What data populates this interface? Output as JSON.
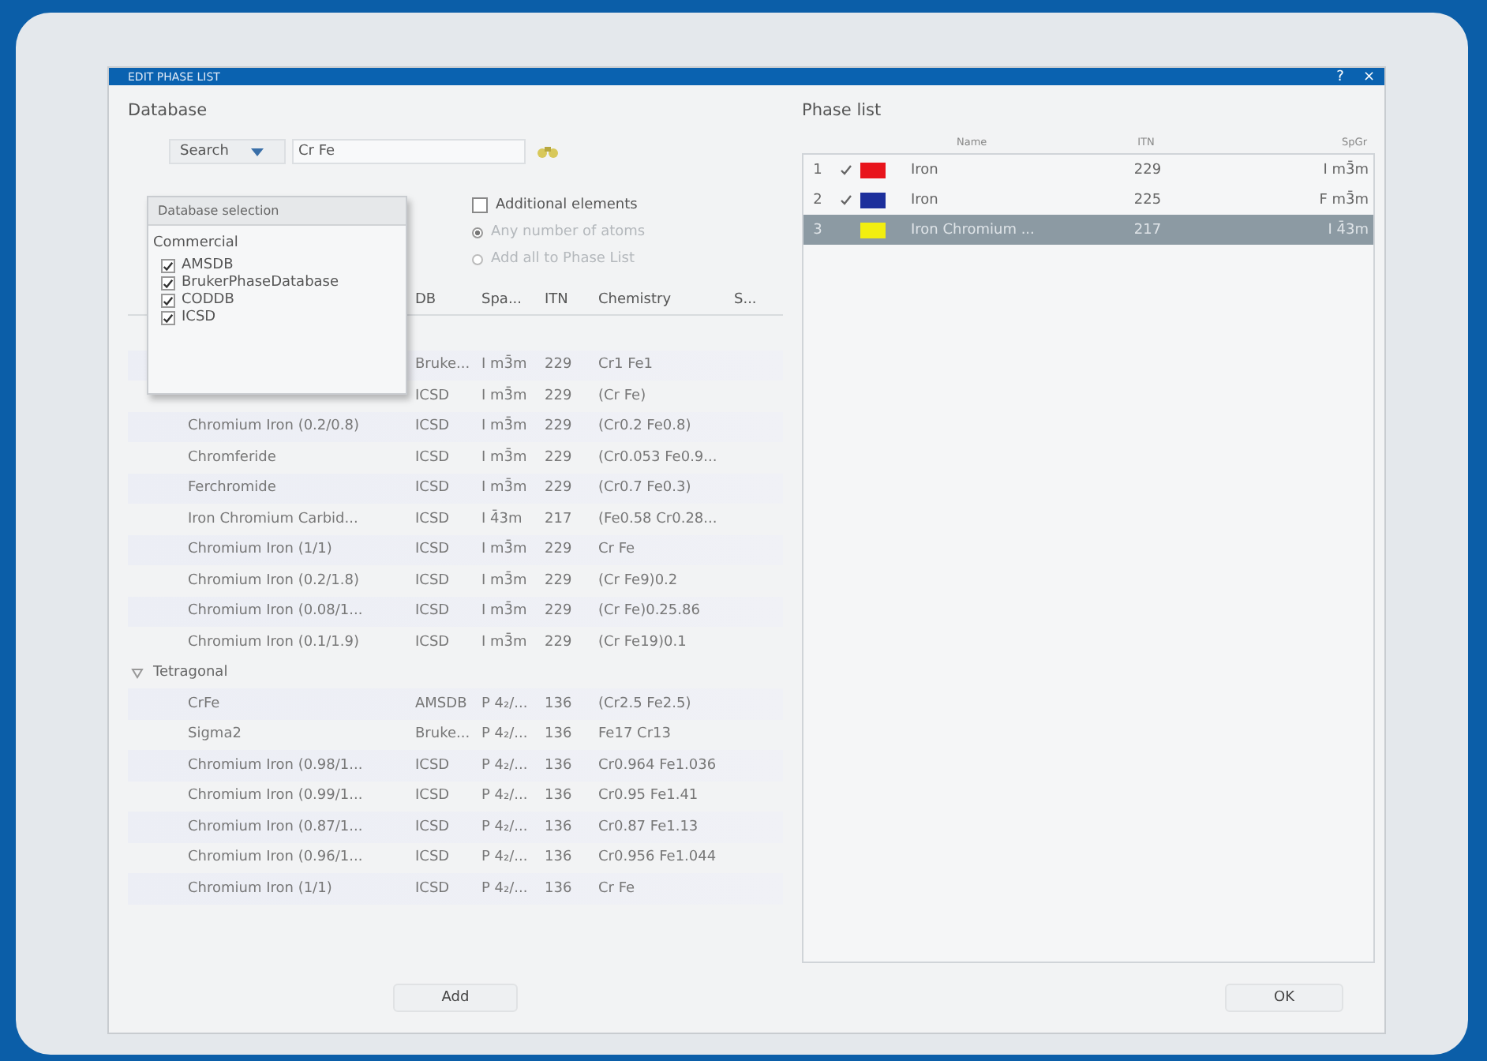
{
  "window": {
    "title": "EDIT PHASE LIST",
    "help": "?",
    "close": "×"
  },
  "database": {
    "heading": "Database",
    "search_mode": "Search",
    "search_value": "Cr Fe",
    "additional_elements": {
      "label": "Additional elements",
      "checked": false
    },
    "options": [
      {
        "label": "Any number of atoms",
        "selected": true,
        "disabled": true
      },
      {
        "label": "Add all to Phase List",
        "selected": false,
        "disabled": true
      }
    ],
    "selection_popup": {
      "title": "Database selection",
      "group": "Commercial",
      "items": [
        {
          "label": "AMSDB",
          "checked": true
        },
        {
          "label": "BrukerPhaseDatabase",
          "checked": true
        },
        {
          "label": "CODDB",
          "checked": true
        },
        {
          "label": "ICSD",
          "checked": true
        }
      ]
    },
    "table": {
      "columns": [
        "DB",
        "Spa...",
        "ITN",
        "Chemistry",
        "S..."
      ],
      "groups": [
        {
          "children": [
            {
              "db": "Bruke...",
              "spg": "I m3̄m",
              "itn": "229",
              "chem": "Cr1 Fe1"
            },
            {
              "db": "ICSD",
              "spg": "I m3̄m",
              "itn": "229",
              "chem": "(Cr Fe)"
            },
            {
              "name": "Chromium Iron (0.2/0.8)",
              "db": "ICSD",
              "spg": "I m3̄m",
              "itn": "229",
              "chem": "(Cr0.2 Fe0.8)"
            },
            {
              "name": "Chromferide",
              "db": "ICSD",
              "spg": "I m3̄m",
              "itn": "229",
              "chem": "(Cr0.053 Fe0.9..."
            },
            {
              "name": "Ferchromide",
              "db": "ICSD",
              "spg": "I m3̄m",
              "itn": "229",
              "chem": "(Cr0.7 Fe0.3)"
            },
            {
              "name": "Iron Chromium Carbid...",
              "db": "ICSD",
              "spg": "I 4̄3m",
              "itn": "217",
              "chem": "(Fe0.58 Cr0.28..."
            },
            {
              "name": "Chromium Iron (1/1)",
              "db": "ICSD",
              "spg": "I m3̄m",
              "itn": "229",
              "chem": "Cr Fe"
            },
            {
              "name": "Chromium Iron (0.2/1.8)",
              "db": "ICSD",
              "spg": "I m3̄m",
              "itn": "229",
              "chem": "(Cr Fe9)0.2"
            },
            {
              "name": "Chromium Iron (0.08/1...",
              "db": "ICSD",
              "spg": "I m3̄m",
              "itn": "229",
              "chem": "(Cr Fe)0.25.86"
            },
            {
              "name": "Chromium Iron (0.1/1.9)",
              "db": "ICSD",
              "spg": "I m3̄m",
              "itn": "229",
              "chem": "(Cr Fe19)0.1"
            }
          ]
        },
        {
          "label": "Tetragonal",
          "expanded": true,
          "children": [
            {
              "name": "CrFe",
              "db": "AMSDB",
              "spg": "P 4₂/...",
              "itn": "136",
              "chem": "(Cr2.5 Fe2.5)"
            },
            {
              "name": "Sigma2",
              "db": "Bruke...",
              "spg": "P 4₂/...",
              "itn": "136",
              "chem": "Fe17 Cr13"
            },
            {
              "name": "Chromium Iron (0.98/1...",
              "db": "ICSD",
              "spg": "P 4₂/...",
              "itn": "136",
              "chem": "Cr0.964 Fe1.036"
            },
            {
              "name": "Chromium Iron (0.99/1...",
              "db": "ICSD",
              "spg": "P 4₂/...",
              "itn": "136",
              "chem": "Cr0.95 Fe1.41"
            },
            {
              "name": "Chromium Iron (0.87/1...",
              "db": "ICSD",
              "spg": "P 4₂/...",
              "itn": "136",
              "chem": "Cr0.87 Fe1.13"
            },
            {
              "name": "Chromium Iron (0.96/1...",
              "db": "ICSD",
              "spg": "P 4₂/...",
              "itn": "136",
              "chem": "Cr0.956 Fe1.044"
            },
            {
              "name": "Chromium Iron (1/1)",
              "db": "ICSD",
              "spg": "P 4₂/...",
              "itn": "136",
              "chem": "Cr Fe"
            }
          ]
        }
      ]
    },
    "add_button": "Add"
  },
  "phase_list": {
    "heading": "Phase list",
    "columns": [
      "Name",
      "ITN",
      "SpGr"
    ],
    "rows": [
      {
        "index": "1",
        "checked": true,
        "color": "#e8141c",
        "name": "Iron",
        "itn": "229",
        "spg": "I m3̄m",
        "selected": false
      },
      {
        "index": "2",
        "checked": true,
        "color": "#1c2f9c",
        "name": "Iron",
        "itn": "225",
        "spg": "F m3̄m",
        "selected": false
      },
      {
        "index": "3",
        "checked": false,
        "color": "#f2ee10",
        "name": "Iron Chromium ...",
        "itn": "217",
        "spg": "I 4̄3m",
        "selected": true
      }
    ]
  },
  "ok_button": "OK"
}
